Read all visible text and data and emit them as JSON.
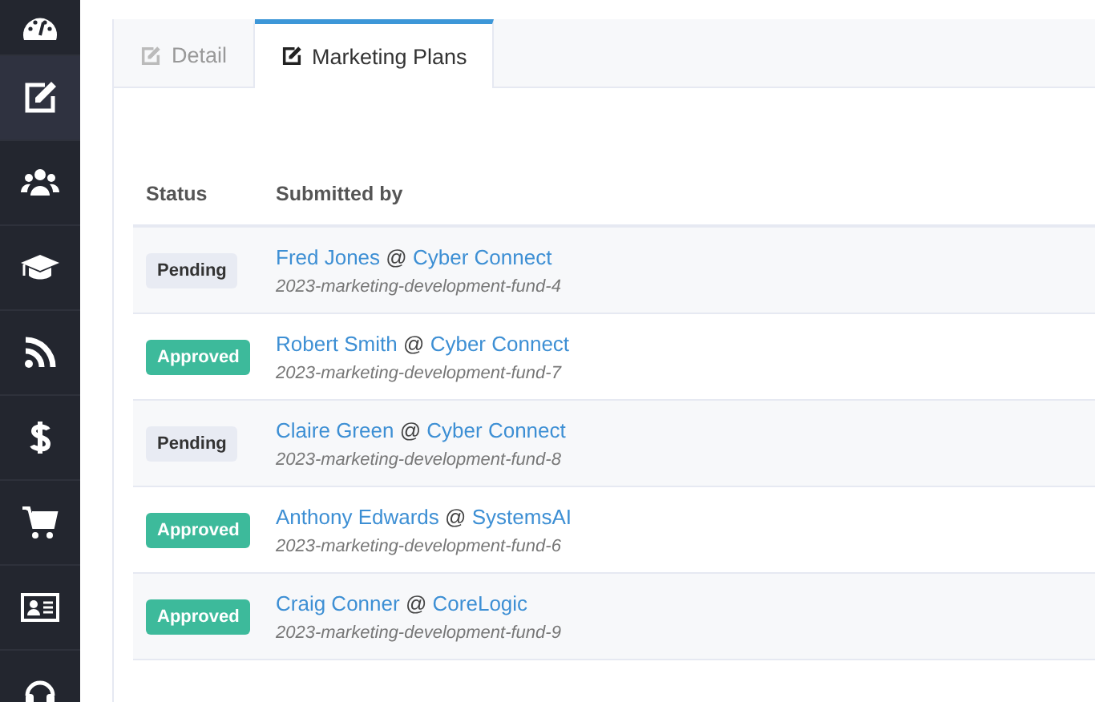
{
  "sidebar": {
    "items": [
      {
        "selected": false
      },
      {
        "selected": true
      },
      {
        "selected": false
      },
      {
        "selected": false
      },
      {
        "selected": false
      },
      {
        "selected": false
      },
      {
        "selected": false
      },
      {
        "selected": false
      },
      {
        "selected": false
      }
    ]
  },
  "tabs": [
    {
      "label": "Detail",
      "selected": false
    },
    {
      "label": "Marketing Plans",
      "selected": true
    }
  ],
  "table": {
    "columns": [
      "Status",
      "Submitted by"
    ],
    "rows": [
      {
        "status": "Pending",
        "kind": "pending",
        "submitted_by": [
          {
            "kind": "person",
            "text": "Fred Jones"
          },
          {
            "kind": "separator",
            "text": "@"
          },
          {
            "kind": "company",
            "text": "Cyber Connect"
          }
        ],
        "plan": "2023-marketing-development-fund-4"
      },
      {
        "status": "Approved",
        "kind": "approved",
        "submitted_by": [
          {
            "kind": "person",
            "text": "Robert Smith"
          },
          {
            "kind": "separator",
            "text": "@"
          },
          {
            "kind": "company",
            "text": "Cyber Connect"
          }
        ],
        "plan": "2023-marketing-development-fund-7"
      },
      {
        "status": "Pending",
        "kind": "pending",
        "submitted_by": [
          {
            "kind": "person",
            "text": "Claire Green"
          },
          {
            "kind": "separator",
            "text": "@"
          },
          {
            "kind": "company",
            "text": "Cyber Connect"
          }
        ],
        "plan": "2023-marketing-development-fund-8"
      },
      {
        "status": "Approved",
        "kind": "approved",
        "submitted_by": [
          {
            "kind": "person",
            "text": "Anthony Edwards"
          },
          {
            "kind": "separator",
            "text": "@"
          },
          {
            "kind": "company",
            "text": "SystemsAI"
          }
        ],
        "plan": "2023-marketing-development-fund-6"
      },
      {
        "status": "Approved",
        "kind": "approved",
        "submitted_by": [
          {
            "kind": "person",
            "text": "Craig Conner"
          },
          {
            "kind": "separator",
            "text": "@"
          },
          {
            "kind": "company",
            "text": "CoreLogic"
          }
        ],
        "plan": "2023-marketing-development-fund-9"
      }
    ]
  }
}
